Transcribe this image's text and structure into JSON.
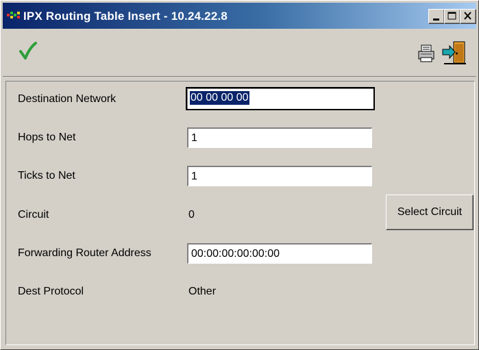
{
  "window": {
    "title": "IPX Routing Table Insert - 10.24.22.8",
    "controls": {
      "minimize": "_",
      "maximize": "□",
      "close": "×"
    }
  },
  "toolbar": {
    "apply_icon": "checkmark-icon",
    "print_icon": "printer-icon",
    "exit_icon": "exit-door-icon"
  },
  "form": {
    "destination_network": {
      "label": "Destination Network",
      "value": "00 00 00 00"
    },
    "hops_to_net": {
      "label": "Hops to Net",
      "value": "1"
    },
    "ticks_to_net": {
      "label": "Ticks to Net",
      "value": "1"
    },
    "circuit": {
      "label": "Circuit",
      "value": "0"
    },
    "select_circuit_button": "Select Circuit",
    "forwarding_router_address": {
      "label": "Forwarding Router Address",
      "value": "00:00:00:00:00:00"
    },
    "dest_protocol": {
      "label": "Dest Protocol",
      "value": "Other"
    }
  },
  "colors": {
    "titlebar_start": "#0a246a",
    "titlebar_end": "#a6caf0",
    "face": "#d4d0c8",
    "check_green": "#2e9e3a",
    "selection": "#0a246a"
  }
}
